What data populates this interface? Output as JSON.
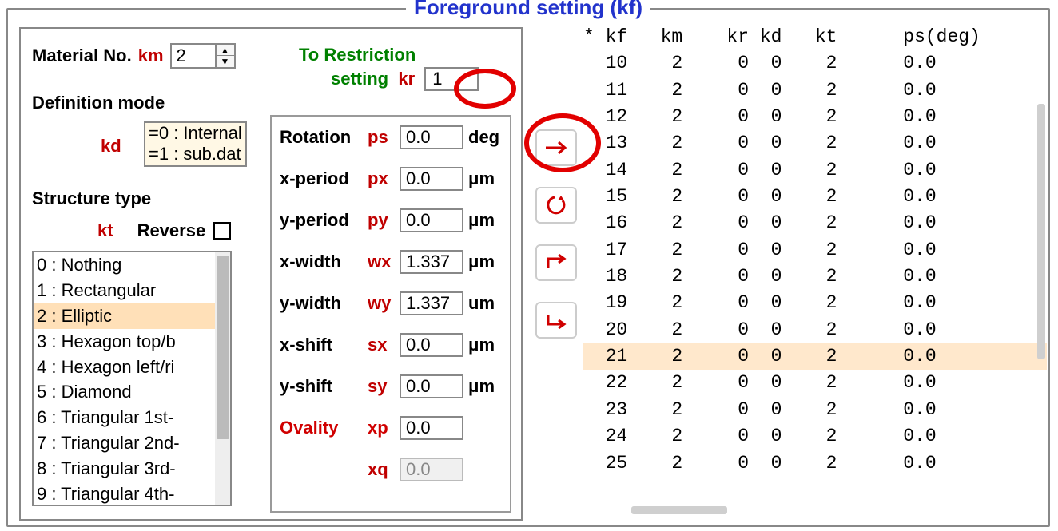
{
  "group_title": "Foreground setting (kf)",
  "material": {
    "label": "Material No.",
    "sym": "km",
    "value": "2"
  },
  "definition_mode": {
    "label": "Definition mode",
    "sym": "kd",
    "opt0": "=0 : Internal",
    "opt1": "=1 : sub.dat"
  },
  "structure_type": {
    "label": "Structure type",
    "sym": "kt",
    "reverse_label": "Reverse",
    "options": [
      "0 : Nothing",
      "1 : Rectangular",
      "2 : Elliptic",
      "3 : Hexagon top/b",
      "4 : Hexagon left/ri",
      "5 : Diamond",
      "6 : Triangular 1st-",
      "7 : Triangular 2nd-",
      "8 : Triangular 3rd-",
      "9 : Triangular 4th-"
    ],
    "selected_index": 2
  },
  "restriction": {
    "line1_a": "To Restriction",
    "line2_a": "setting",
    "sym": "kr",
    "value": "1"
  },
  "params": {
    "rotation": {
      "name": "Rotation",
      "sym": "ps",
      "value": "0.0",
      "unit": "deg"
    },
    "xperiod": {
      "name": "x-period",
      "sym": "px",
      "value": "0.0",
      "unit": "μm"
    },
    "yperiod": {
      "name": "y-period",
      "sym": "py",
      "value": "0.0",
      "unit": "μm"
    },
    "xwidth": {
      "name": "x-width",
      "sym": "wx",
      "value": "1.337",
      "unit": "μm"
    },
    "ywidth": {
      "name": "y-width",
      "sym": "wy",
      "value": "1.337",
      "unit": "um"
    },
    "xshift": {
      "name": "x-shift",
      "sym": "sx",
      "value": "0.0",
      "unit": "μm"
    },
    "yshift": {
      "name": "y-shift",
      "sym": "sy",
      "value": "0.0",
      "unit": "μm"
    },
    "ovality": {
      "name": "Ovality",
      "sym": "xp",
      "value": "0.0",
      "unit": ""
    },
    "xq": {
      "name": "",
      "sym": "xq",
      "value": "0.0",
      "unit": ""
    }
  },
  "action_buttons": {
    "apply": "→",
    "refresh": "↻",
    "forward": "↱",
    "down": "↳"
  },
  "table": {
    "header": "* kf   km    kr kd   kt      ps(deg)",
    "rows": [
      {
        "kf": "10",
        "km": "2",
        "kr": "0",
        "kd": "0",
        "kt": "2",
        "ps": "0.0"
      },
      {
        "kf": "11",
        "km": "2",
        "kr": "0",
        "kd": "0",
        "kt": "2",
        "ps": "0.0"
      },
      {
        "kf": "12",
        "km": "2",
        "kr": "0",
        "kd": "0",
        "kt": "2",
        "ps": "0.0"
      },
      {
        "kf": "13",
        "km": "2",
        "kr": "0",
        "kd": "0",
        "kt": "2",
        "ps": "0.0"
      },
      {
        "kf": "14",
        "km": "2",
        "kr": "0",
        "kd": "0",
        "kt": "2",
        "ps": "0.0"
      },
      {
        "kf": "15",
        "km": "2",
        "kr": "0",
        "kd": "0",
        "kt": "2",
        "ps": "0.0"
      },
      {
        "kf": "16",
        "km": "2",
        "kr": "0",
        "kd": "0",
        "kt": "2",
        "ps": "0.0"
      },
      {
        "kf": "17",
        "km": "2",
        "kr": "0",
        "kd": "0",
        "kt": "2",
        "ps": "0.0"
      },
      {
        "kf": "18",
        "km": "2",
        "kr": "0",
        "kd": "0",
        "kt": "2",
        "ps": "0.0"
      },
      {
        "kf": "19",
        "km": "2",
        "kr": "0",
        "kd": "0",
        "kt": "2",
        "ps": "0.0"
      },
      {
        "kf": "20",
        "km": "2",
        "kr": "0",
        "kd": "0",
        "kt": "2",
        "ps": "0.0"
      },
      {
        "kf": "21",
        "km": "2",
        "kr": "0",
        "kd": "0",
        "kt": "2",
        "ps": "0.0"
      },
      {
        "kf": "22",
        "km": "2",
        "kr": "0",
        "kd": "0",
        "kt": "2",
        "ps": "0.0"
      },
      {
        "kf": "23",
        "km": "2",
        "kr": "0",
        "kd": "0",
        "kt": "2",
        "ps": "0.0"
      },
      {
        "kf": "24",
        "km": "2",
        "kr": "0",
        "kd": "0",
        "kt": "2",
        "ps": "0.0"
      },
      {
        "kf": "25",
        "km": "2",
        "kr": "0",
        "kd": "0",
        "kt": "2",
        "ps": "0.0"
      }
    ],
    "selected_index": 11
  }
}
